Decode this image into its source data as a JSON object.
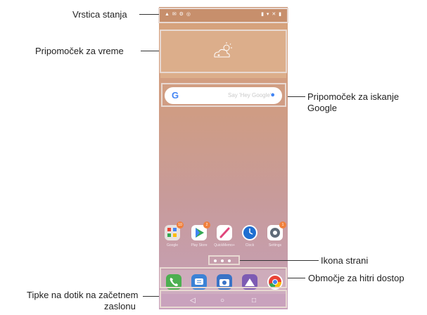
{
  "callouts": {
    "status_bar": "Vrstica stanja",
    "weather_widget": "Pripomoček za vreme",
    "google_search_line1": "Pripomoček za iskanje",
    "google_search_line2": "Google",
    "page_icon": "Ikona strani",
    "quick_access": "Območje za hitri dostop",
    "home_touch_line1": "Tipke na dotik na začetnem",
    "home_touch_line2": "zaslonu"
  },
  "search": {
    "logo": "G",
    "placeholder": "Say 'Hey Google'",
    "mic": "🎤"
  },
  "apps": [
    {
      "name": "Google",
      "badge": "10",
      "color": "#e9e0dc"
    },
    {
      "name": "Play Store",
      "badge": "2",
      "color": "#ffffff"
    },
    {
      "name": "QuickMemo+",
      "badge": "",
      "color": "#ffffff"
    },
    {
      "name": "Clock",
      "badge": "",
      "color": "#ffffff"
    },
    {
      "name": "Settings",
      "badge": "1",
      "color": "#ffffff"
    }
  ],
  "dock": [
    {
      "name": "Phone",
      "color": "#4caf50"
    },
    {
      "name": "Messages",
      "color": "#3b82d6"
    },
    {
      "name": "Camera",
      "color": "#3a73c6"
    },
    {
      "name": "Gallery",
      "color": "#7d5bb3"
    },
    {
      "name": "Chrome",
      "color": "#ffffff"
    }
  ],
  "navbar": {
    "back": "◁",
    "home": "○",
    "recents": "□"
  },
  "colors": {
    "wallpaper_top": "#d8a37b",
    "wallpaper_bottom": "#c6a0b9",
    "highlight": "#e8d9d2"
  }
}
